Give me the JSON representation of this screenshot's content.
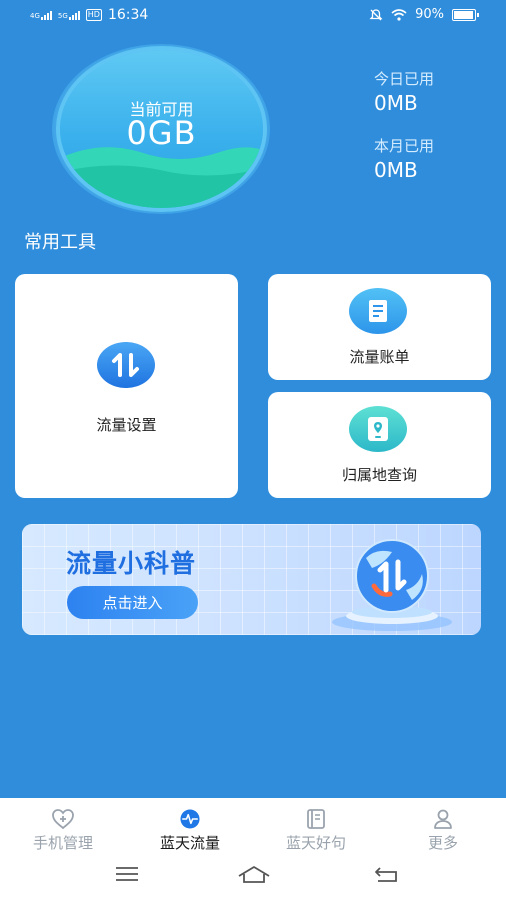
{
  "status_bar": {
    "signal1": "4G",
    "signal2": "5G",
    "hd": "HD",
    "time": "16:34",
    "battery": "90%"
  },
  "usage": {
    "available_label": "当前可用",
    "available_value": "0GB",
    "today_label": "今日已用",
    "today_value": "0MB",
    "month_label": "本月已用",
    "month_value": "0MB"
  },
  "tools": {
    "title": "常用工具",
    "items": [
      {
        "label": "流量设置",
        "icon": "transfer-arrows-icon"
      },
      {
        "label": "流量账单",
        "icon": "bill-document-icon"
      },
      {
        "label": "归属地查询",
        "icon": "location-tablet-icon"
      }
    ]
  },
  "banner": {
    "title": "流量小科普",
    "button": "点击进入"
  },
  "tabs": [
    {
      "label": "手机管理",
      "icon": "heart-plus-icon",
      "active": false
    },
    {
      "label": "蓝天流量",
      "icon": "pulse-icon",
      "active": true
    },
    {
      "label": "蓝天好句",
      "icon": "notebook-icon",
      "active": false
    },
    {
      "label": "更多",
      "icon": "person-icon",
      "active": false
    }
  ],
  "colors": {
    "background": "#2f8ddb",
    "accent": "#1f73e0",
    "card": "#ffffff"
  }
}
